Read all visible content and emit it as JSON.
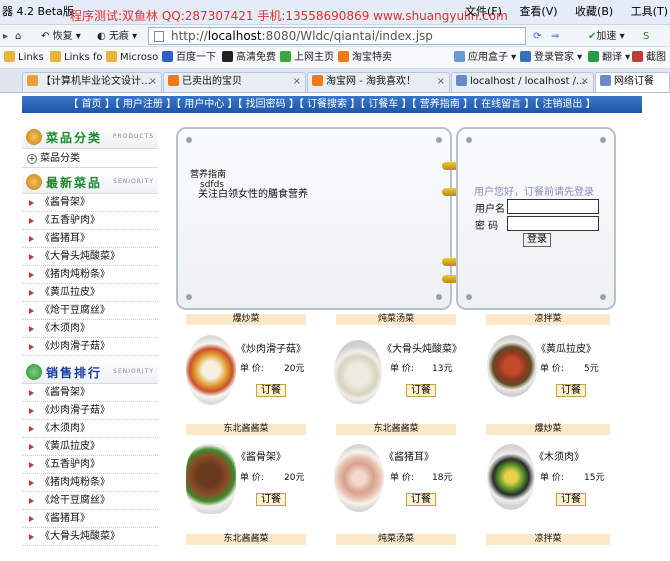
{
  "browser": {
    "title_left": "器 4.2 Beta版",
    "promo": "程序测试:双鱼林 QQ:287307421 手机:13558690869 www.shuangyulin.com",
    "menus": [
      "文件(F)",
      "查看(V)",
      "收藏(B)",
      "工具(T)"
    ],
    "back_label": "恢复",
    "no_image_label": "无痕",
    "url_prefix": "http://",
    "url_host": "localhost",
    "url_rest": ":8080/Wldc/qiantai/index.jsp",
    "speed_label": "加速",
    "bookmarks": [
      "Links",
      "Links fo",
      "Microso",
      "百度一下",
      "高清免费",
      "上网主页",
      "淘宝特卖",
      "应用盒子",
      "登录管家",
      "翻译",
      "截图"
    ],
    "tabs": [
      {
        "label": "【计算机毕业论文设计…",
        "close": "×"
      },
      {
        "label": "已卖出的宝贝",
        "close": "×"
      },
      {
        "label": "淘宝网 - 淘我喜欢！",
        "close": "×"
      },
      {
        "label": "localhost / localhost /...",
        "close": "×"
      },
      {
        "label": "网络订餐",
        "close": ""
      }
    ]
  },
  "site": {
    "nav": "【 首页 】【 用户注册 】【 用户中心 】【 找回密码 】【 订餐搜索 】【 订餐车 】【 营养指南 】【 在线留言 】【 注销退出 】",
    "sidebar": {
      "category_title": "菜品分类",
      "category_en": "PRODUCTS",
      "category_item": "菜品分类",
      "newest_title": "最新菜品",
      "newest_en": "SENIORITY",
      "newest": [
        "《酱骨架》",
        "《五香驴肉》",
        "《酱猪耳》",
        "《大骨头炖酸菜》",
        "《猪肉炖粉条》",
        "《黄瓜拉皮》",
        "《炝干豆腐丝》",
        "《木须肉》",
        "《炒肉滑子菇》"
      ],
      "ranking_title": "销售排行",
      "ranking_en": "SENIORITY",
      "ranking": [
        "《酱骨架》",
        "《炒肉滑子菇》",
        "《木须肉》",
        "《黄瓜拉皮》",
        "《五香驴肉》",
        "《猪肉炖粉条》",
        "《炝干豆腐丝》",
        "《酱猪耳》",
        "《大骨头炖酸菜》"
      ]
    },
    "notice": {
      "line1": "营养指南",
      "line2": "sdfds",
      "line3": "关注白领女性的膳食营养"
    },
    "login": {
      "hint": "用户您好，订餐前请先登录",
      "username_label": "用户名",
      "password_label": "密 码",
      "button": "登录"
    },
    "price_label": "单  价:",
    "order_label": "订餐",
    "rows": [
      {
        "cats": [
          "爆炒菜",
          "炖菜汤菜",
          "凉拌菜"
        ],
        "items": [
          {
            "name": "《炒肉滑子菇》",
            "price": "20元"
          },
          {
            "name": "《大骨头炖酸菜》",
            "price": "13元"
          },
          {
            "name": "《黄瓜拉皮》",
            "price": "5元"
          }
        ]
      },
      {
        "cats": [
          "东北酱酱菜",
          "东北酱酱菜",
          "爆炒菜"
        ],
        "items": [
          {
            "name": "《酱骨架》",
            "price": "20元"
          },
          {
            "name": "《酱猪耳》",
            "price": "18元"
          },
          {
            "name": "《木须肉》",
            "price": "15元"
          }
        ]
      }
    ],
    "row3_cats": [
      "东北酱酱菜",
      "炖菜汤菜",
      "凉拌菜"
    ]
  }
}
